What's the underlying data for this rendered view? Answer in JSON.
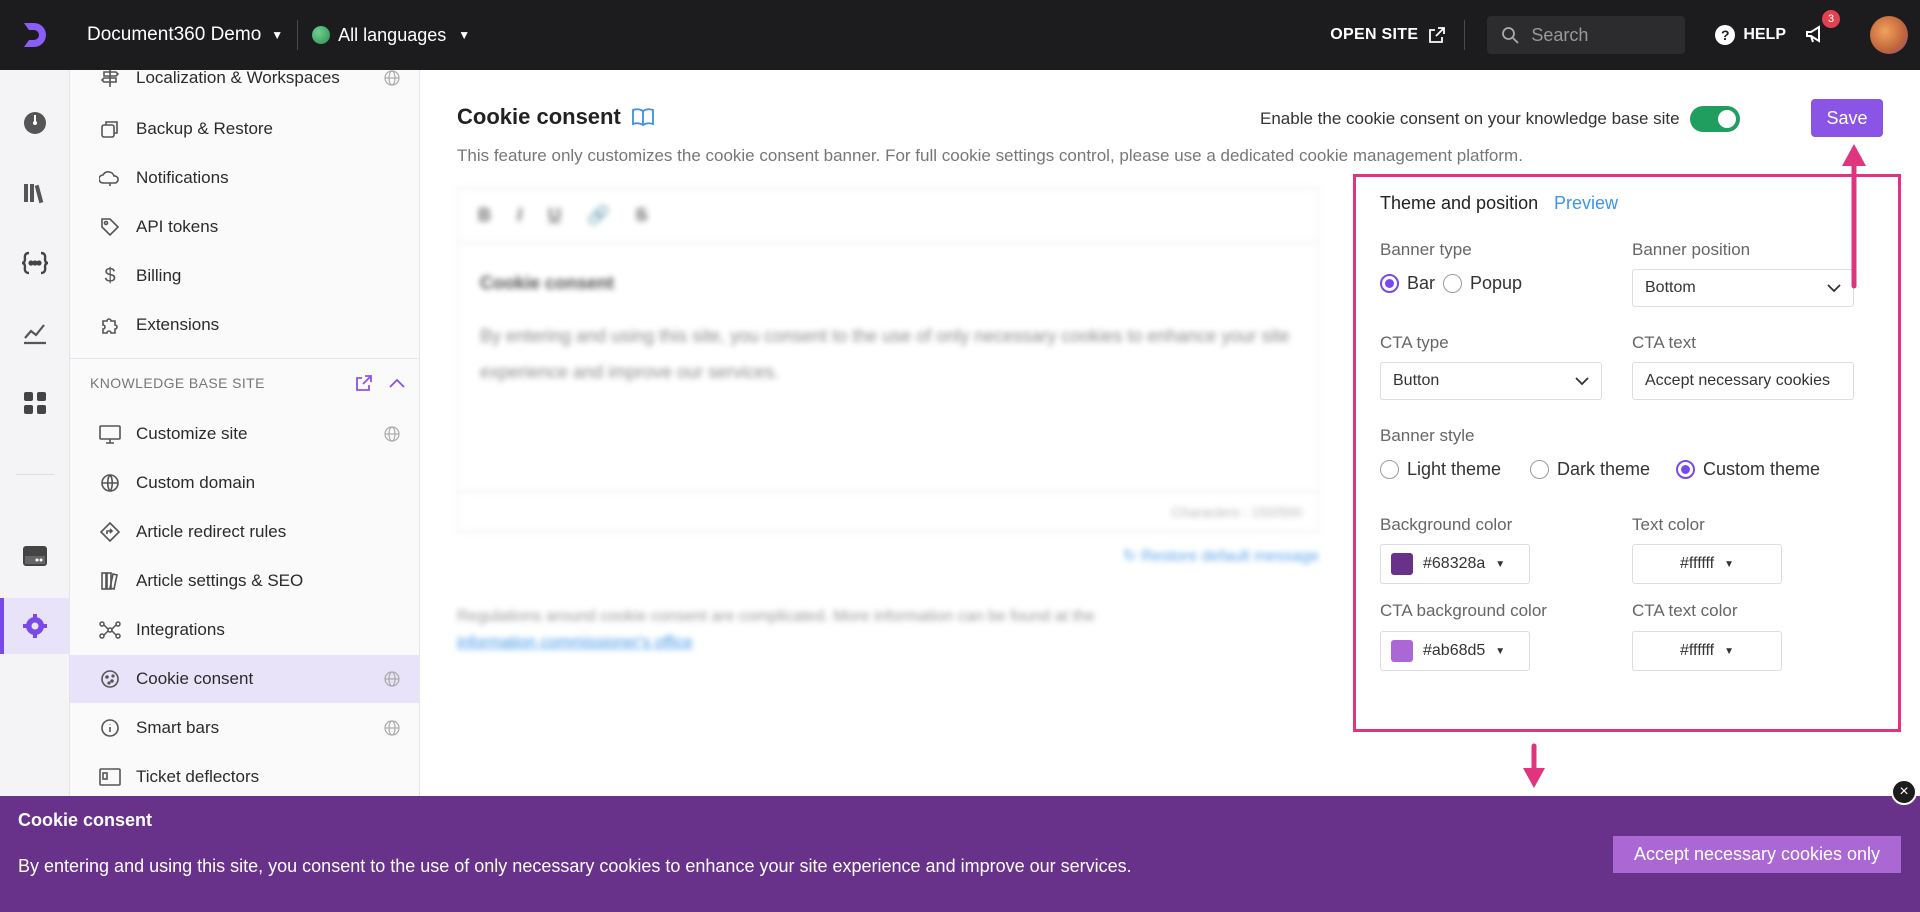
{
  "topbar": {
    "project_name": "Document360 Demo",
    "language": "All languages",
    "open_site": "OPEN SITE",
    "search_placeholder": "Search",
    "help": "HELP",
    "notifications_count": "3"
  },
  "sidebar": {
    "items_top": [
      {
        "label": "Localization & Workspaces",
        "icon": "signpost-icon",
        "lang": true
      },
      {
        "label": "Backup & Restore",
        "icon": "backup-icon",
        "lang": false
      },
      {
        "label": "Notifications",
        "icon": "bell-cloud-icon",
        "lang": false
      },
      {
        "label": "API tokens",
        "icon": "tag-icon",
        "lang": false
      },
      {
        "label": "Billing",
        "icon": "dollar-icon",
        "lang": false
      },
      {
        "label": "Extensions",
        "icon": "puzzle-icon",
        "lang": false
      }
    ],
    "section_title": "KNOWLEDGE BASE SITE",
    "items_kb": [
      {
        "label": "Customize site",
        "icon": "monitor-icon",
        "lang": true
      },
      {
        "label": "Custom domain",
        "icon": "globe-icon",
        "lang": false
      },
      {
        "label": "Article redirect rules",
        "icon": "redirect-icon",
        "lang": false
      },
      {
        "label": "Article settings & SEO",
        "icon": "books-icon",
        "lang": false
      },
      {
        "label": "Integrations",
        "icon": "integrations-icon",
        "lang": false
      },
      {
        "label": "Cookie consent",
        "icon": "cookie-icon",
        "lang": true,
        "active": true
      },
      {
        "label": "Smart bars",
        "icon": "info-icon",
        "lang": true
      },
      {
        "label": "Ticket deflectors",
        "icon": "ticket-icon",
        "lang": false
      }
    ]
  },
  "main": {
    "title": "Cookie consent",
    "subtitle": "This feature only customizes the cookie consent banner. For full cookie settings control, please use a dedicated cookie management platform.",
    "enable_label": "Enable the cookie consent on your knowledge base site",
    "enable_on": true,
    "save": "Save",
    "editor": {
      "toolbar": [
        "B",
        "I",
        "U",
        "🔗",
        "S"
      ],
      "heading": "Cookie consent",
      "body": "By entering and using this site, you consent to the use of only necessary cookies to enhance your site experience and improve our services.",
      "characters": "Characters : 150/500",
      "restore": "Restore default message"
    },
    "regulations": "Regulations around cookie consent are complicated. More information can be found at the",
    "regulations_link": "information commissioner's office"
  },
  "panel": {
    "tab_theme": "Theme and position",
    "tab_preview": "Preview",
    "banner_type_label": "Banner type",
    "banner_type_options": [
      "Bar",
      "Popup"
    ],
    "banner_type_selected": "Bar",
    "banner_position_label": "Banner position",
    "banner_position_value": "Bottom",
    "cta_type_label": "CTA type",
    "cta_type_value": "Button",
    "cta_text_label": "CTA text",
    "cta_text_value": "Accept necessary cookies",
    "banner_style_label": "Banner style",
    "banner_style_options": [
      "Light theme",
      "Dark theme",
      "Custom theme"
    ],
    "banner_style_selected": "Custom theme",
    "background_color_label": "Background color",
    "background_color_value": "#68328a",
    "text_color_label": "Text color",
    "text_color_value": "#ffffff",
    "cta_bg_color_label": "CTA background color",
    "cta_bg_color_value": "#ab68d5",
    "cta_text_color_label": "CTA text color",
    "cta_text_color_value": "#ffffff"
  },
  "banner": {
    "title": "Cookie consent",
    "text": "By entering and using this site, you consent to the use of only necessary cookies to enhance your site experience and improve our services.",
    "button": "Accept necessary cookies only",
    "close": "×"
  },
  "colors": {
    "accent": "#8a55e6",
    "highlight_border": "#e0347e",
    "banner_bg": "#68328a",
    "banner_cta": "#ab68d5",
    "toggle_on": "#1f9e5f"
  }
}
